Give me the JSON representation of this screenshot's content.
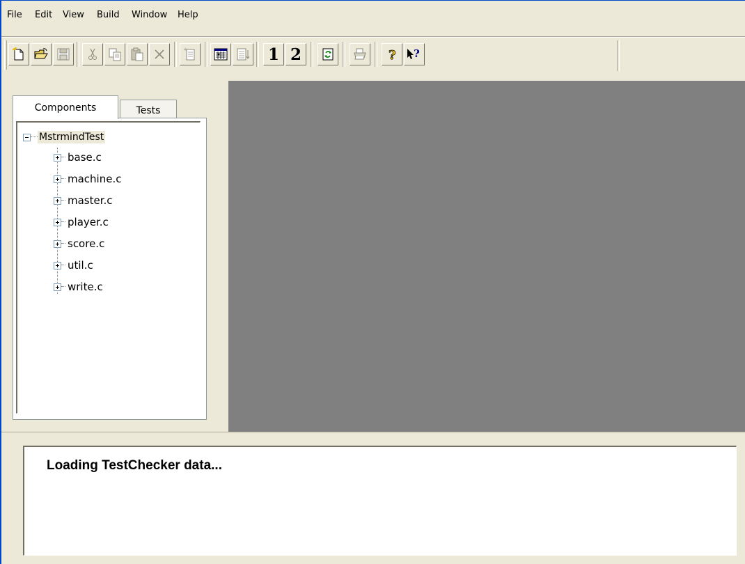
{
  "menu": {
    "items": [
      "File",
      "Edit",
      "View",
      "Build",
      "Window",
      "Help"
    ]
  },
  "toolbar": {
    "buttons": [
      {
        "name": "new-file-icon",
        "state": "enabled"
      },
      {
        "name": "open-folder-icon",
        "state": "enabled"
      },
      {
        "name": "save-icon",
        "state": "disabled"
      },
      {
        "name": "cut-icon",
        "state": "disabled"
      },
      {
        "name": "copy-icon",
        "state": "disabled"
      },
      {
        "name": "paste-icon",
        "state": "disabled"
      },
      {
        "name": "delete-icon",
        "state": "disabled"
      },
      {
        "name": "new-test-icon",
        "state": "disabled"
      },
      {
        "name": "build-grid-icon",
        "state": "enabled"
      },
      {
        "name": "list-sort-icon",
        "state": "disabled"
      },
      {
        "name": "view-1",
        "state": "enabled"
      },
      {
        "name": "view-2",
        "state": "enabled"
      },
      {
        "name": "refresh-icon",
        "state": "enabled"
      },
      {
        "name": "print-icon",
        "state": "disabled"
      },
      {
        "name": "help-icon",
        "state": "enabled"
      },
      {
        "name": "context-help-icon",
        "state": "enabled"
      }
    ],
    "view1_label": "1",
    "view2_label": "2"
  },
  "left_panel": {
    "tabs": [
      {
        "label": "Components",
        "active": true
      },
      {
        "label": "Tests",
        "active": false
      }
    ],
    "tree": {
      "root": "MstrmindTest",
      "children": [
        "base.c",
        "machine.c",
        "master.c",
        "player.c",
        "score.c",
        "util.c",
        "write.c"
      ]
    }
  },
  "output": {
    "message": "Loading TestChecker data..."
  },
  "colors": {
    "face": "#ece9d8",
    "mdi_background": "#808080",
    "title_blue": "#0047c8"
  }
}
